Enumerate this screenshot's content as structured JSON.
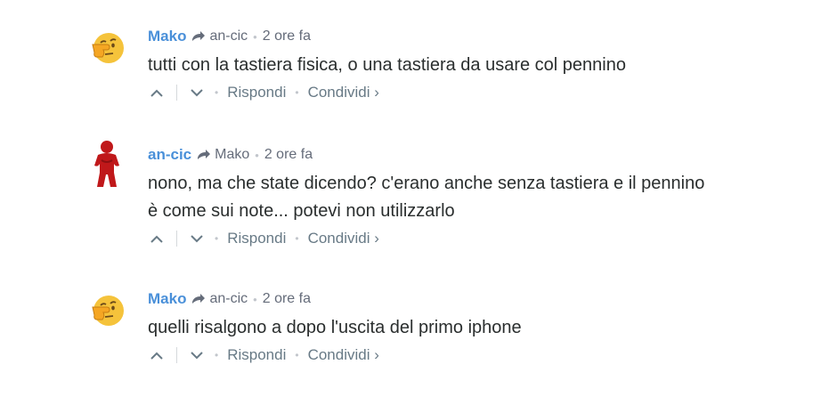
{
  "comments": [
    {
      "author": "Mako",
      "reply_to": "an-cic",
      "time": "2 ore fa",
      "avatar_icon": "thinking-face-emoji",
      "lines": [
        "tutti con la tastiera fisica, o una tastiera da usare col pennino"
      ]
    },
    {
      "author": "an-cic",
      "reply_to": "Mako",
      "time": "2 ore fa",
      "avatar_icon": "red-figure",
      "lines": [
        "nono, ma che state dicendo? c'erano anche senza tastiera e il pennino",
        "è come sui note... potevi non utilizzarlo"
      ]
    },
    {
      "author": "Mako",
      "reply_to": "an-cic",
      "time": "2 ore fa",
      "avatar_icon": "thinking-face-emoji",
      "lines": [
        "quelli risalgono a dopo l'uscita del primo iphone"
      ]
    }
  ],
  "actions": {
    "reply_label": "Rispondi",
    "share_label": "Condividi ›"
  },
  "colors": {
    "author": "#4a90d9",
    "meta": "#656c7a",
    "text": "#2a2e2e"
  }
}
